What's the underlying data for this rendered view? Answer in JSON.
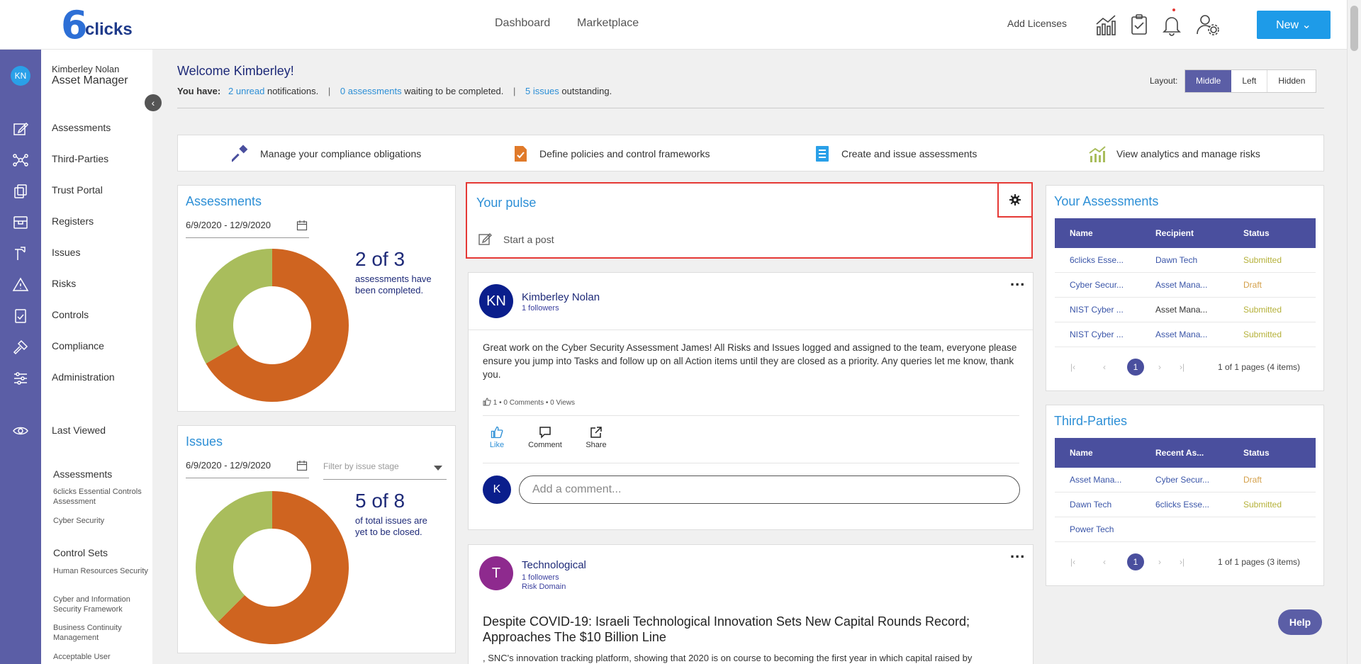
{
  "header": {
    "logo_text": "clicks",
    "logo_number": "6",
    "nav": [
      "Dashboard",
      "Marketplace"
    ],
    "add_licenses": "Add Licenses",
    "new_button": "New",
    "icons": [
      "analytics-icon",
      "clipboard-check-icon",
      "bell-icon",
      "user-settings-icon"
    ]
  },
  "user": {
    "initials": "KN",
    "name": "Kimberley Nolan",
    "role": "Asset Manager"
  },
  "sidebar": {
    "items": [
      "Assessments",
      "Third-Parties",
      "Trust Portal",
      "Registers",
      "Issues",
      "Risks",
      "Controls",
      "Compliance",
      "Administration"
    ],
    "last_viewed": "Last Viewed",
    "recent_assessments_heading": "Assessments",
    "recent_assessments": [
      "6clicks Essential Controls Assessment",
      "Cyber Security"
    ],
    "control_sets_heading": "Control Sets",
    "control_sets": [
      "Human Resources Security",
      "Cyber and Information Security Framework",
      "Business Continuity Management",
      "Acceptable User"
    ]
  },
  "welcome": {
    "title": "Welcome Kimberley!",
    "you_have": "You have:",
    "unread": "2 unread",
    "notifications": "notifications.",
    "sep": "|",
    "assessments_link": "0 assessments",
    "waiting": "waiting to be completed.",
    "issues_link": "5 issues",
    "outstanding": "outstanding."
  },
  "layout": {
    "label": "Layout:",
    "options": [
      "Middle",
      "Left",
      "Hidden"
    ],
    "active": "Middle"
  },
  "features": [
    "Manage your compliance obligations",
    "Define policies and control frameworks",
    "Create and issue assessments",
    "View analytics and manage risks"
  ],
  "assessments_card": {
    "title": "Assessments",
    "date_range": "6/9/2020 - 12/9/2020",
    "big": "2 of 3",
    "sub": "assessments have been completed.",
    "donut": {
      "completed": 2,
      "total": 3,
      "colors": [
        "#cf6420",
        "#a9bd5c"
      ]
    }
  },
  "issues_card": {
    "title": "Issues",
    "date_range": "6/9/2020 - 12/9/2020",
    "filter_placeholder": "Filter by issue stage",
    "big": "5 of 8",
    "sub": "of total issues are yet to be closed.",
    "donut": {
      "open": 5,
      "total": 8,
      "colors": [
        "#cf6420",
        "#a9bd5c"
      ]
    }
  },
  "pulse": {
    "title": "Your pulse",
    "start_post": "Start a post"
  },
  "post1": {
    "initials": "KN",
    "author": "Kimberley Nolan",
    "followers": "1 followers",
    "menu": "...",
    "body": "Great work on the Cyber Security Assessment James! All Risks and Issues logged and assigned to the team, everyone please ensure you jump into Tasks and follow up on all Action items until they are closed as a priority. Any queries let me know, thank you.",
    "likes": "1",
    "comments": "0 Comments",
    "views": "0 Views",
    "actions": [
      "Like",
      "Comment",
      "Share"
    ],
    "commenter_initial": "K",
    "comment_placeholder": "Add a comment..."
  },
  "post2": {
    "initial": "T",
    "author": "Technological",
    "followers": "1 followers",
    "domain": "Risk Domain",
    "menu": "...",
    "headline": "Despite COVID-19: Israeli Technological Innovation Sets New Capital Rounds Record; Approaches The $10 Billion Line",
    "snippet": ", SNC's innovation tracking platform, showing that 2020 is on course to becoming the first year in which capital raised by"
  },
  "your_assessments": {
    "title": "Your Assessments",
    "columns": [
      "Name",
      "Recipient",
      "Status"
    ],
    "rows": [
      {
        "name": "6clicks Esse...",
        "recipient": "Dawn Tech",
        "status": "Submitted"
      },
      {
        "name": "Cyber Secur...",
        "recipient": "Asset Mana...",
        "status": "Draft"
      },
      {
        "name": "NIST Cyber ...",
        "recipient": "Asset Mana...",
        "status": "Submitted"
      },
      {
        "name": "NIST Cyber ...",
        "recipient": "Asset Mana...",
        "status": "Submitted"
      }
    ],
    "page": "1",
    "page_info": "1 of 1 pages (4 items)"
  },
  "third_parties": {
    "title": "Third-Parties",
    "columns": [
      "Name",
      "Recent As...",
      "Status"
    ],
    "rows": [
      {
        "name": "Asset Mana...",
        "recent": "Cyber Secur...",
        "status": "Draft"
      },
      {
        "name": "Dawn Tech",
        "recent": "6clicks Esse...",
        "status": "Submitted"
      },
      {
        "name": "Power Tech",
        "recent": "",
        "status": ""
      }
    ],
    "page": "1",
    "page_info": "1 of 1 pages (3 items)"
  },
  "help": "Help",
  "colors": {
    "accent": "#1e9be8",
    "rail": "#5b5ea6",
    "table_header": "#4a4f9e",
    "donut_primary": "#cf6420",
    "donut_secondary": "#a9bd5c",
    "highlight": "#e53935"
  }
}
